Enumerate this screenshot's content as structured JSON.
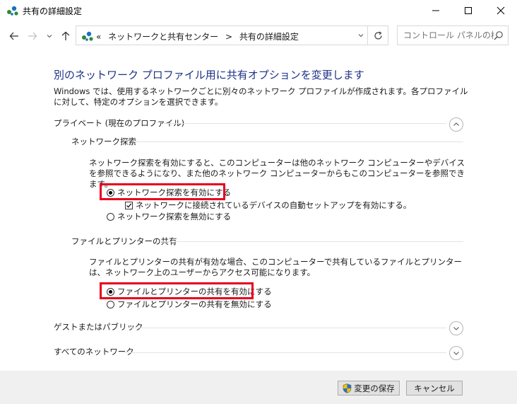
{
  "window": {
    "title": "共有の詳細設定"
  },
  "nav": {
    "breadcrumbs": [
      "«",
      "ネットワークと共有センター",
      ">",
      "共有の詳細設定"
    ],
    "search_placeholder": "コントロール パネルの検索"
  },
  "page": {
    "heading": "別のネットワーク プロファイル用に共有オプションを変更します",
    "description": "Windows では、使用するネットワークごとに別々のネットワーク プロファイルが作成されます。各プロファイルに対して、特定のオプションを選択できます。"
  },
  "private": {
    "label": "プライベート (現在のプロファイル)",
    "expanded": true,
    "discovery": {
      "title": "ネットワーク探索",
      "text": "ネットワーク探索を有効にすると、このコンピューターは他のネットワーク コンピューターやデバイスを参照できるようになり、また他のネットワーク コンピューターからもこのコンピューターを参照できます。",
      "enable_label": "ネットワーク探索を有効にする",
      "auto_setup_label": "ネットワークに接続されているデバイスの自動セットアップを有効にする。",
      "disable_label": "ネットワーク探索を無効にする",
      "enabled": true,
      "auto_setup": true
    },
    "file_sharing": {
      "title": "ファイルとプリンターの共有",
      "text": "ファイルとプリンターの共有が有効な場合、このコンピューターで共有しているファイルとプリンターは、ネットワーク上のユーザーからアクセス可能になります。",
      "enable_label": "ファイルとプリンターの共有を有効にする",
      "disable_label": "ファイルとプリンターの共有を無効にする",
      "enabled": true
    }
  },
  "guest": {
    "label": "ゲストまたはパブリック",
    "expanded": false
  },
  "all_networks": {
    "label": "すべてのネットワーク",
    "expanded": false
  },
  "footer": {
    "save_label": "変更の保存",
    "cancel_label": "キャンセル"
  },
  "colors": {
    "heading": "#1e3287",
    "highlight": "#e6001e"
  }
}
